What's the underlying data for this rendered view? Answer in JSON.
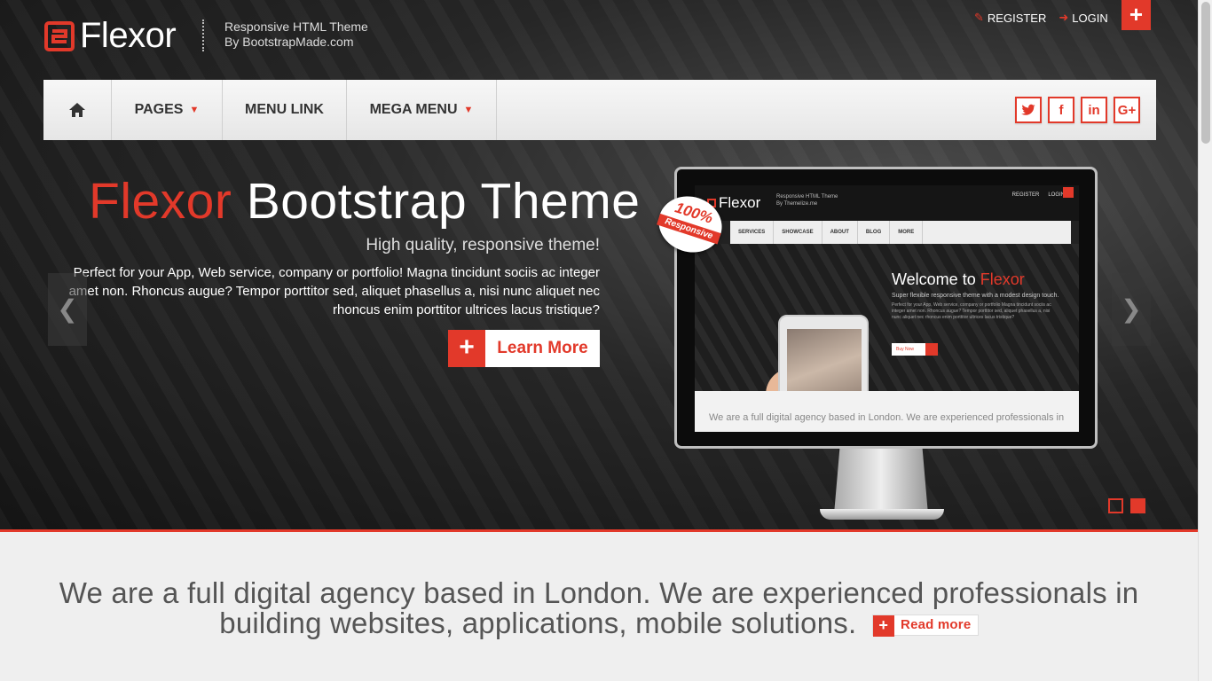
{
  "brand": {
    "name": "Flexor",
    "tagline_line1": "Responsive HTML Theme",
    "tagline_line2": "By BootstrapMade.com"
  },
  "colors": {
    "accent": "#e2392a",
    "nav_bg": "#efefef",
    "intro_bg": "#efefef"
  },
  "top_links": {
    "register": "REGISTER",
    "login": "LOGIN",
    "register_icon": "edit-icon",
    "login_icon": "sign-in-icon",
    "plus_icon": "plus-icon"
  },
  "nav": {
    "home_icon": "home-icon",
    "pages": "PAGES",
    "menu_link": "MENU LINK",
    "mega_menu": "MEGA MENU",
    "socials": [
      "twitter-icon",
      "facebook-icon",
      "linkedin-icon",
      "google-plus-icon"
    ]
  },
  "hero": {
    "title_accent": "Flexor",
    "title_rest": "Bootstrap Theme",
    "subtitle": "High quality, responsive theme!",
    "description": "Perfect for your App, Web service, company or portfolio! Magna tincidunt sociis ac integer amet non. Rhoncus augue? Tempor porttitor sed, aliquet phasellus a, nisi nunc aliquet nec rhoncus enim porttitor ultrices lacus tristique?",
    "cta_label": "Learn More",
    "slide_count": 2,
    "active_slide": 2
  },
  "mockup": {
    "badge_percent": "100%",
    "badge_label": "Responsive",
    "logo": "Flexor",
    "tagline_line1": "Responsive HTML Theme",
    "tagline_line2": "By Themelize.me",
    "register": "REGISTER",
    "login": "LOGIN",
    "nav": [
      "SERVICES",
      "SHOWCASE",
      "ABOUT",
      "BLOG",
      "MORE"
    ],
    "welcome": "Welcome to",
    "welcome_accent": "Flexor",
    "small_text": "Super flexible responsive theme with a modest design touch.",
    "small_text2": "Perfect for your App, Web service, company or portfolio Magna tincidunt sociis ac integer amet non. Rhoncus augue? Tempor porttitor sed, aliquet phasellus a, nisi nunc aliquet nec rhoncus enim porttitor ultrices lacus tristique?",
    "buy_now": "Buy Now",
    "bottom_text": "We are a full digital agency based in London. We are experienced professionals in"
  },
  "intro": {
    "text": "We are a full digital agency based in London. We are experienced professionals in building websites, applications, mobile solutions.",
    "read_more": "Read more"
  }
}
